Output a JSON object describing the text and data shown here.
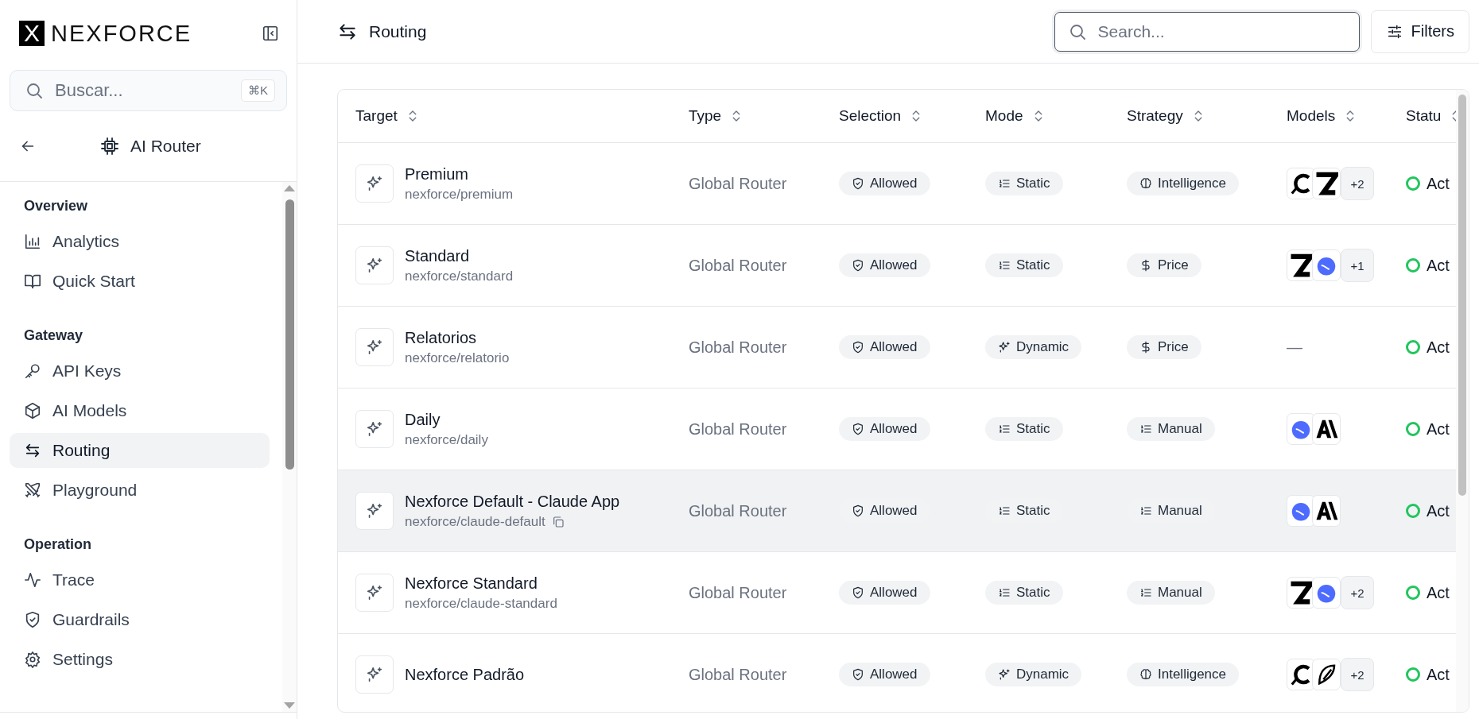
{
  "brand": {
    "mark": "X",
    "name": "NEXFORCE"
  },
  "sidebar": {
    "search": {
      "placeholder": "Buscar...",
      "shortcut": "⌘K"
    },
    "context": {
      "title": "AI Router"
    },
    "sections": [
      {
        "title": "Overview",
        "items": [
          {
            "label": "Analytics",
            "kind": "chart",
            "selected": false
          },
          {
            "label": "Quick Start",
            "kind": "book",
            "selected": false
          }
        ]
      },
      {
        "title": "Gateway",
        "items": [
          {
            "label": "API Keys",
            "kind": "key",
            "selected": false
          },
          {
            "label": "AI Models",
            "kind": "cube",
            "selected": false
          },
          {
            "label": "Routing",
            "kind": "routing",
            "selected": true
          },
          {
            "label": "Playground",
            "kind": "swords",
            "selected": false
          }
        ]
      },
      {
        "title": "Operation",
        "items": [
          {
            "label": "Trace",
            "kind": "pulse",
            "selected": false
          },
          {
            "label": "Guardrails",
            "kind": "shield",
            "selected": false
          },
          {
            "label": "Settings",
            "kind": "gear",
            "selected": false
          }
        ]
      }
    ]
  },
  "header": {
    "title": "Routing",
    "search": {
      "placeholder": "Search..."
    },
    "filters_button": "Filters"
  },
  "table": {
    "columns": [
      "Target",
      "Type",
      "Selection",
      "Mode",
      "Strategy",
      "Models",
      "Statu"
    ],
    "rows": [
      {
        "name": "Premium",
        "slug": "nexforce/premium",
        "type": "Global Router",
        "selection": "Allowed",
        "mode": {
          "label": "Static",
          "kind": "static"
        },
        "strategy": {
          "label": "Intelligence",
          "kind": "intelligence"
        },
        "models": [
          {
            "kind": "c-mark"
          },
          {
            "kind": "z-mark"
          }
        ],
        "more": "+2",
        "status": {
          "label": "Act",
          "kind": "active"
        },
        "hovered": false
      },
      {
        "name": "Standard",
        "slug": "nexforce/standard",
        "type": "Global Router",
        "selection": "Allowed",
        "mode": {
          "label": "Static",
          "kind": "static"
        },
        "strategy": {
          "label": "Price",
          "kind": "price"
        },
        "models": [
          {
            "kind": "z-mark"
          },
          {
            "kind": "whale-mark"
          }
        ],
        "more": "+1",
        "status": {
          "label": "Act",
          "kind": "active"
        },
        "hovered": false
      },
      {
        "name": "Relatorios",
        "slug": "nexforce/relatorio",
        "type": "Global Router",
        "selection": "Allowed",
        "mode": {
          "label": "Dynamic",
          "kind": "dynamic"
        },
        "strategy": {
          "label": "Price",
          "kind": "price"
        },
        "models_empty": "—",
        "status": {
          "label": "Act",
          "kind": "active"
        },
        "hovered": false
      },
      {
        "name": "Daily",
        "slug": "nexforce/daily",
        "type": "Global Router",
        "selection": "Allowed",
        "mode": {
          "label": "Static",
          "kind": "static"
        },
        "strategy": {
          "label": "Manual",
          "kind": "manual"
        },
        "models": [
          {
            "kind": "whale-mark"
          },
          {
            "kind": "a-mark"
          }
        ],
        "status": {
          "label": "Act",
          "kind": "active"
        },
        "hovered": false
      },
      {
        "name": "Nexforce Default - Claude App",
        "slug": "nexforce/claude-default",
        "type": "Global Router",
        "selection": "Allowed",
        "mode": {
          "label": "Static",
          "kind": "static"
        },
        "strategy": {
          "label": "Manual",
          "kind": "manual"
        },
        "models": [
          {
            "kind": "whale-mark"
          },
          {
            "kind": "a-mark"
          }
        ],
        "status": {
          "label": "Act",
          "kind": "active"
        },
        "hovered": true
      },
      {
        "name": "Nexforce Standard",
        "slug": "nexforce/claude-standard",
        "type": "Global Router",
        "selection": "Allowed",
        "mode": {
          "label": "Static",
          "kind": "static"
        },
        "strategy": {
          "label": "Manual",
          "kind": "manual"
        },
        "models": [
          {
            "kind": "z-mark"
          },
          {
            "kind": "whale-mark"
          }
        ],
        "more": "+2",
        "status": {
          "label": "Act",
          "kind": "active"
        },
        "hovered": false
      },
      {
        "name": "Nexforce Padrão",
        "type": "Global Router",
        "selection": "Allowed",
        "mode": {
          "label": "Dynamic",
          "kind": "dynamic"
        },
        "strategy": {
          "label": "Intelligence",
          "kind": "intelligence"
        },
        "models": [
          {
            "kind": "c-mark"
          },
          {
            "kind": "feather-mark"
          }
        ],
        "more": "+2",
        "status": {
          "label": "Act",
          "kind": "active"
        },
        "hovered": false
      }
    ]
  }
}
